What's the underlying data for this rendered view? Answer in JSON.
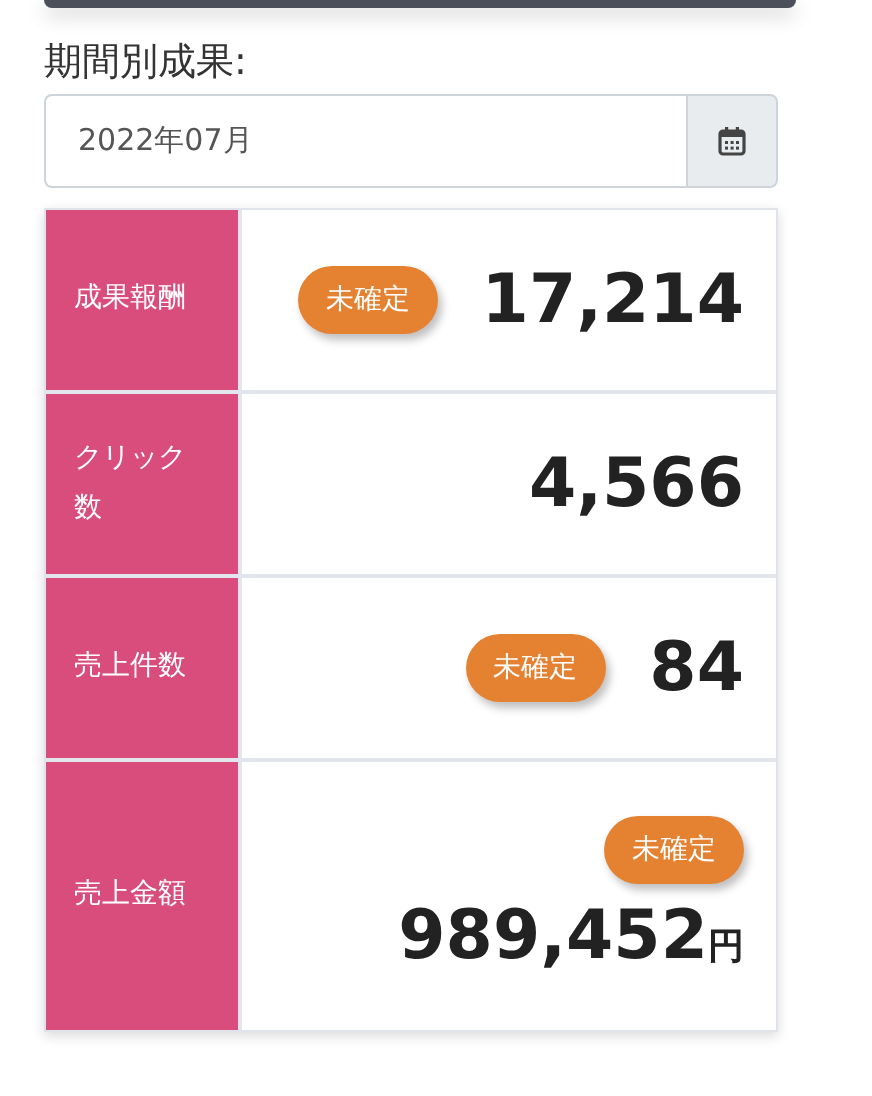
{
  "period": {
    "label": "期間別成果:",
    "value": "2022年07月"
  },
  "metrics": [
    {
      "label": "成果報酬",
      "badge": "未確定",
      "value": "17,214",
      "kind": "inline"
    },
    {
      "label": "クリック数",
      "value": "4,566",
      "kind": "inline"
    },
    {
      "label": "売上件数",
      "badge": "未確定",
      "value": "84",
      "kind": "inline"
    },
    {
      "label": "売上金額",
      "badge": "未確定",
      "value": "989,452",
      "unit": "円",
      "kind": "stacked"
    }
  ]
}
